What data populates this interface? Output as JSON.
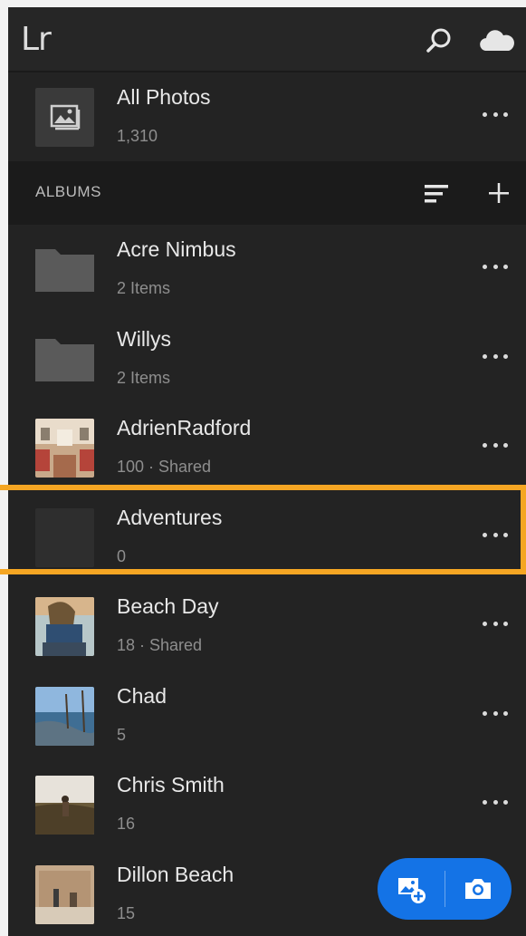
{
  "app": {
    "logo": "Lr",
    "search_icon": "search-icon",
    "cloud_icon": "cloud-icon"
  },
  "all_photos": {
    "title": "All Photos",
    "count": "1,310"
  },
  "albums_header": {
    "label": "ALBUMS",
    "sort_icon": "sort-icon",
    "add_icon": "plus-icon"
  },
  "albums": [
    {
      "name": "Acre Nimbus",
      "meta": "2 Items",
      "thumb": "folder"
    },
    {
      "name": "Willys",
      "meta": "2 Items",
      "thumb": "folder"
    },
    {
      "name": "AdrienRadford",
      "meta": "100 · Shared",
      "thumb": "photo-train"
    },
    {
      "name": "Adventures",
      "meta": "0",
      "thumb": "empty",
      "highlighted": true
    },
    {
      "name": "Beach Day",
      "meta": "18 · Shared",
      "thumb": "photo-person-sitting"
    },
    {
      "name": "Chad",
      "meta": "5",
      "thumb": "photo-lake"
    },
    {
      "name": "Chris Smith",
      "meta": "16",
      "thumb": "photo-hiker"
    },
    {
      "name": "Dillon Beach",
      "meta": "15",
      "thumb": "photo-wall"
    }
  ],
  "fab": {
    "add_photo_icon": "add-photo-icon",
    "camera_icon": "camera-icon"
  },
  "colors": {
    "background": "#232323",
    "highlight": "#f5a623",
    "accent": "#1473e6"
  }
}
